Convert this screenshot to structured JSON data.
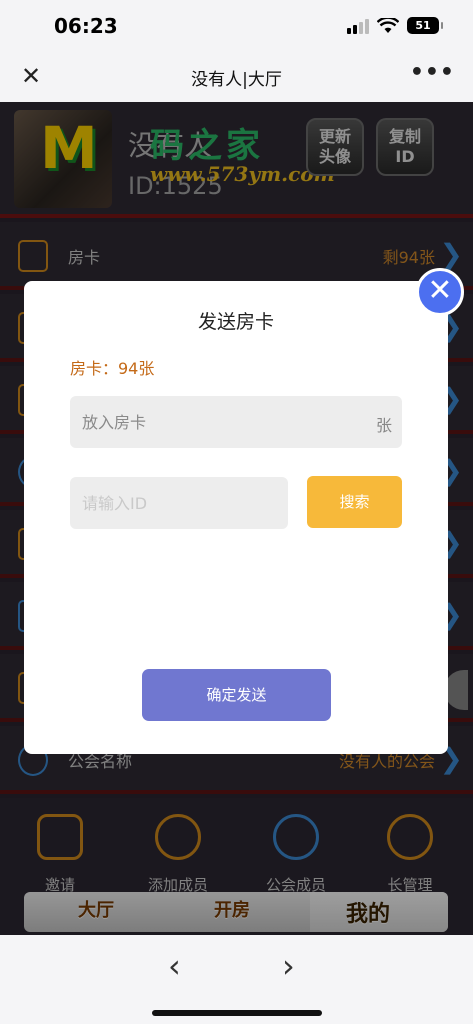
{
  "status_bar": {
    "time": "06:23",
    "battery": "51"
  },
  "nav": {
    "title": "没有人|大厅"
  },
  "profile": {
    "name": "没有人",
    "id_text": "ID:1525",
    "update_avatar_label": "更新\n头像",
    "copy_id_label": "复制\nID"
  },
  "watermark": {
    "text": "码之家",
    "url": "www.573ym.com"
  },
  "rows": [
    {
      "label": "房卡",
      "value": "剩94张"
    },
    {
      "label": "公会名称",
      "value": "没有人的公会"
    }
  ],
  "features": [
    {
      "label": "邀请"
    },
    {
      "label": "添加成员"
    },
    {
      "label": "公会成员"
    },
    {
      "label": "长管理"
    }
  ],
  "tabs": [
    {
      "label": "大厅"
    },
    {
      "label": "开房"
    },
    {
      "label": "我的"
    }
  ],
  "modal": {
    "title": "发送房卡",
    "card_count": "房卡：94张",
    "card_input_placeholder": "放入房卡",
    "card_unit": "张",
    "id_input_placeholder": "请输入ID",
    "search_label": "搜索",
    "confirm_label": "确定发送"
  },
  "colors": {
    "accent_orange": "#f7b93a",
    "confirm_purple": "#7077d0",
    "close_blue": "#4c6ff0",
    "card_text": "#c46a18"
  }
}
